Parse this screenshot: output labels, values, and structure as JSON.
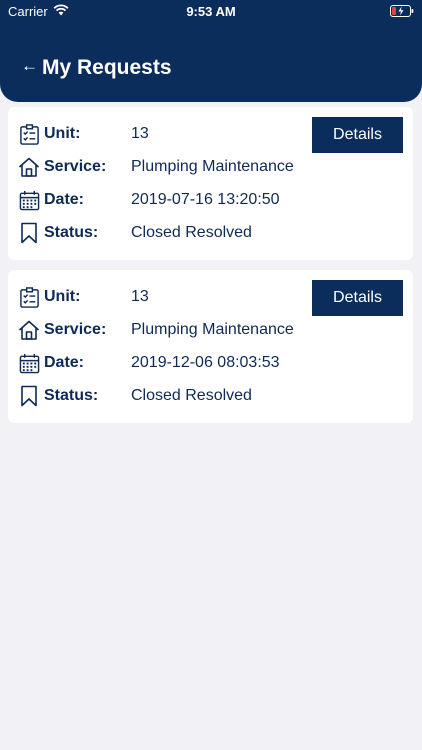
{
  "status_bar": {
    "carrier": "Carrier",
    "time": "9:53 AM"
  },
  "header": {
    "back_icon": "arrow-left-icon",
    "back_glyph": "←",
    "title": "My Requests"
  },
  "field_labels": {
    "unit": "Unit:",
    "service": "Service:",
    "date": "Date:",
    "status": "Status:"
  },
  "details_label": "Details",
  "requests": [
    {
      "unit": "13",
      "service": "Plumping Maintenance",
      "date": "2019-07-16 13:20:50",
      "status": "Closed Resolved"
    },
    {
      "unit": "13",
      "service": "Plumping Maintenance",
      "date": "2019-12-06 08:03:53",
      "status": "Closed Resolved"
    }
  ],
  "colors": {
    "primary": "#0b2d5c",
    "background": "#f1f1f6",
    "card": "#ffffff",
    "text": "#0e2a55"
  }
}
